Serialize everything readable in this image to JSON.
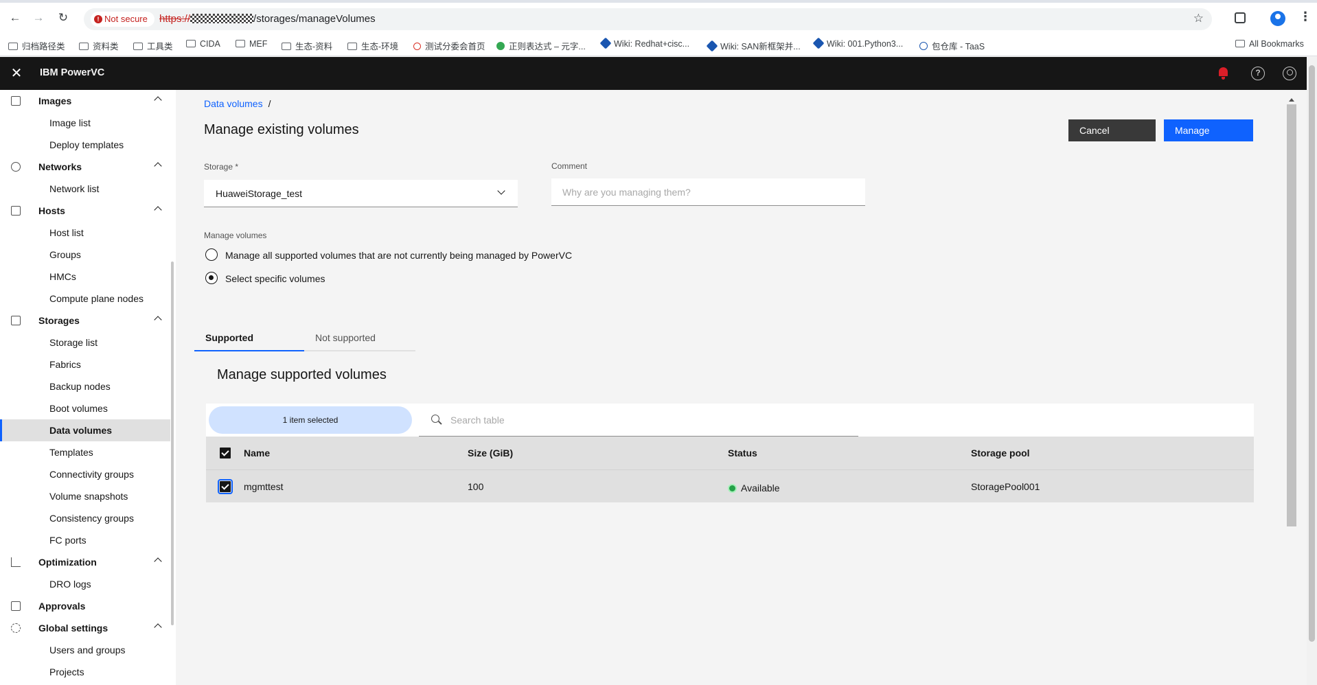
{
  "browser": {
    "not_secure": "Not secure",
    "url_scheme": "https://",
    "url_path": "/storages/manageVolumes",
    "bookmarks": [
      "归档路径类",
      "资料类",
      "工具类",
      "CIDA",
      "MEF",
      "生态-资料",
      "生态-环境",
      "测试分委会首页",
      "正则表达式 – 元字...",
      "Wiki: Redhat+cisc...",
      "Wiki: SAN新框架并...",
      "Wiki: 001.Python3...",
      "包仓库 - TaaS"
    ],
    "all_bookmarks": "All Bookmarks"
  },
  "app": {
    "name": "IBM PowerVC"
  },
  "sidenav": {
    "sections": {
      "images": "Images",
      "networks": "Networks",
      "hosts": "Hosts",
      "storages": "Storages",
      "optimization": "Optimization",
      "approvals": "Approvals",
      "global_settings": "Global settings"
    },
    "items": {
      "image_list": "Image list",
      "deploy_templates": "Deploy templates",
      "network_list": "Network list",
      "host_list": "Host list",
      "groups": "Groups",
      "hmcs": "HMCs",
      "compute_plane_nodes": "Compute plane nodes",
      "storage_list": "Storage list",
      "fabrics": "Fabrics",
      "backup_nodes": "Backup nodes",
      "boot_volumes": "Boot volumes",
      "data_volumes": "Data volumes",
      "templates": "Templates",
      "connectivity_groups": "Connectivity groups",
      "volume_snapshots": "Volume snapshots",
      "consistency_groups": "Consistency groups",
      "fc_ports": "FC ports",
      "dro_logs": "DRO logs",
      "users_and_groups": "Users and groups",
      "projects": "Projects"
    },
    "active": "Data volumes"
  },
  "main": {
    "breadcrumb": "Data volumes",
    "breadcrumb_sep": "/",
    "title": "Manage existing volumes",
    "cancel_label": "Cancel",
    "manage_label": "Manage",
    "storage_label": "Storage *",
    "storage_value": "HuaweiStorage_test",
    "comment_label": "Comment",
    "comment_placeholder": "Why are you managing them?",
    "manage_volumes_label": "Manage volumes",
    "radio_all": "Manage all supported volumes that are not currently being managed by PowerVC",
    "radio_specific": "Select specific volumes",
    "radio_selected": "specific",
    "tab_supported": "Supported",
    "tab_not_supported": "Not supported",
    "table_title": "Manage supported volumes",
    "batch_text": "1 item selected",
    "search_placeholder": "Search table",
    "columns": [
      "Name",
      "Size (GiB)",
      "Status",
      "Storage pool"
    ],
    "rows": [
      {
        "name": "mgmttest",
        "size": "100",
        "status": "Available",
        "pool": "StoragePool001",
        "selected": true
      }
    ]
  },
  "colors": {
    "primary": "#0f62fe",
    "header": "#161616",
    "status_available": "#24a148",
    "notification": "#da1e28"
  }
}
